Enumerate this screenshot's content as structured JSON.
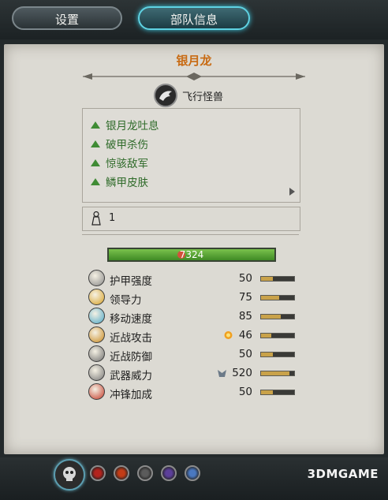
{
  "tabs": [
    {
      "label": "设置",
      "active": false
    },
    {
      "label": "部队信息",
      "active": true
    }
  ],
  "unit": {
    "name": "银月龙",
    "class_label": "飞行怪兽",
    "class_icon": "dragon-head-icon"
  },
  "abilities": [
    {
      "label": "银月龙吐息"
    },
    {
      "label": "破甲杀伤"
    },
    {
      "label": "惊骇敌军"
    },
    {
      "label": "鳞甲皮肤"
    }
  ],
  "entity_count": "1",
  "hp": "7324",
  "stats": [
    {
      "name": "护甲强度",
      "value": "50",
      "fill": 0.35,
      "icon": "armor-icon",
      "color": "#8a8a8a"
    },
    {
      "name": "领导力",
      "value": "75",
      "fill": 0.55,
      "icon": "leadership-icon",
      "color": "#d8a227"
    },
    {
      "name": "移动速度",
      "value": "85",
      "fill": 0.6,
      "icon": "speed-icon",
      "color": "#4ea8c7"
    },
    {
      "name": "近战攻击",
      "value": "46",
      "fill": 0.3,
      "icon": "melee-attack-icon",
      "color": "#c98a1f",
      "bonus": "fire-icon"
    },
    {
      "name": "近战防御",
      "value": "50",
      "fill": 0.35,
      "icon": "melee-defense-icon",
      "color": "#6f6f6f"
    },
    {
      "name": "武器威力",
      "value": "520",
      "fill": 0.85,
      "icon": "weapon-strength-icon",
      "color": "#777777",
      "bonus": "armor-piercing-icon"
    },
    {
      "name": "冲锋加成",
      "value": "50",
      "fill": 0.35,
      "icon": "charge-bonus-icon",
      "color": "#c43a2a"
    }
  ],
  "faction_icon": "faction-skull-icon",
  "attributes": [
    {
      "icon": "attr-red-icon",
      "color": "#b3231d"
    },
    {
      "icon": "attr-fire-icon",
      "color": "#c33c16"
    },
    {
      "icon": "attr-skull-icon",
      "color": "#5b5b5b"
    },
    {
      "icon": "attr-purple-icon",
      "color": "#5c3f9a"
    },
    {
      "icon": "attr-blue-icon",
      "color": "#4a78c0"
    }
  ],
  "watermark": "3DMGAME"
}
